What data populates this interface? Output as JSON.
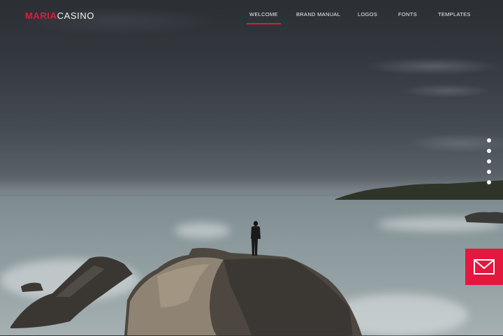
{
  "brand": {
    "accent": "MARIA",
    "rest": "CASINO",
    "accent_color": "#e4173f"
  },
  "nav": {
    "items": [
      {
        "label": "WELCOME",
        "active": true
      },
      {
        "label": "BRAND MANUAL",
        "active": false
      },
      {
        "label": "LOGOS",
        "active": false
      },
      {
        "label": "FONTS",
        "active": false
      },
      {
        "label": "TEMPLATES",
        "active": false
      }
    ]
  },
  "slides": {
    "count": 5
  },
  "contact": {
    "icon": "envelope-icon"
  },
  "hero": {
    "image": "man standing on a coastal rock overlooking the sea"
  }
}
